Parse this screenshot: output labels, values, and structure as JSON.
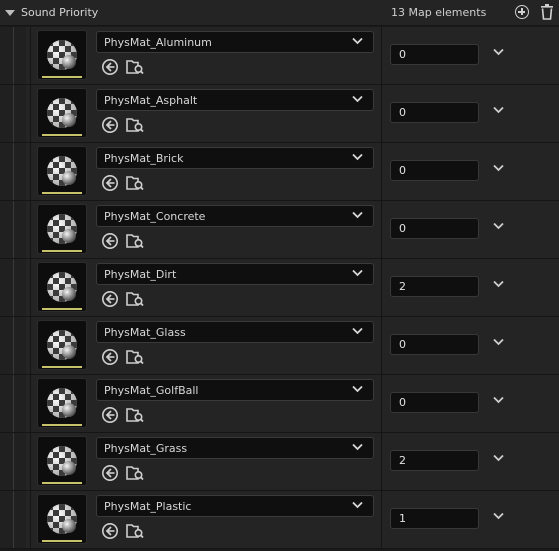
{
  "header": {
    "title": "Sound Priority",
    "count_label": "13 Map elements"
  },
  "rows": [
    {
      "material": "PhysMat_Aluminum",
      "value": "0"
    },
    {
      "material": "PhysMat_Asphalt",
      "value": "0"
    },
    {
      "material": "PhysMat_Brick",
      "value": "0"
    },
    {
      "material": "PhysMat_Concrete",
      "value": "0"
    },
    {
      "material": "PhysMat_Dirt",
      "value": "2"
    },
    {
      "material": "PhysMat_Glass",
      "value": "0"
    },
    {
      "material": "PhysMat_GolfBall",
      "value": "0"
    },
    {
      "material": "PhysMat_Grass",
      "value": "2"
    },
    {
      "material": "PhysMat_Plastic",
      "value": "1"
    }
  ],
  "icons": {
    "collapse": "triangle-down-icon",
    "add": "plus-circle-icon",
    "delete": "trash-icon",
    "thumbnail": "physical-material-icon",
    "dropdown": "chevron-down-icon",
    "use_selected": "arrow-left-circle-icon",
    "browse": "folder-search-icon"
  },
  "colors": {
    "accent_underline": "#c8c26a",
    "background": "#242424",
    "field": "#0f0f0f"
  }
}
